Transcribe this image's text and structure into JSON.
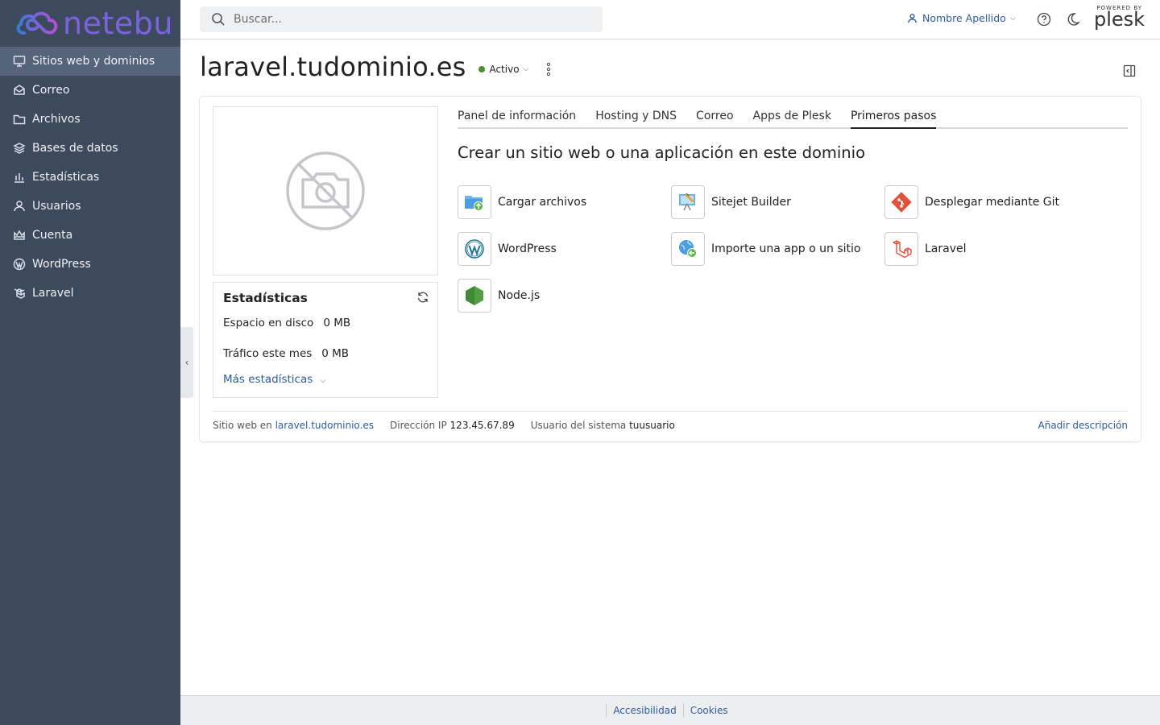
{
  "brand": {
    "logo_text": "netebu",
    "logo_color": "#7d62e0",
    "powered_by": "POWERED BY",
    "plesk": "plesk"
  },
  "sidebar": {
    "items": [
      {
        "label": "Sitios web y dominios",
        "icon": "monitor-icon",
        "active": true
      },
      {
        "label": "Correo",
        "icon": "envelope-icon"
      },
      {
        "label": "Archivos",
        "icon": "folder-icon"
      },
      {
        "label": "Bases de datos",
        "icon": "database-layers-icon"
      },
      {
        "label": "Estadísticas",
        "icon": "bar-chart-icon"
      },
      {
        "label": "Usuarios",
        "icon": "user-icon"
      },
      {
        "label": "Cuenta",
        "icon": "crown-icon"
      },
      {
        "label": "WordPress",
        "icon": "wordpress-icon"
      },
      {
        "label": "Laravel",
        "icon": "laravel-icon"
      }
    ]
  },
  "header": {
    "search_placeholder": "Buscar...",
    "user_name": "Nombre Apellido"
  },
  "domain": {
    "title": "laravel.tudominio.es",
    "status": "Activo",
    "status_color": "#4a8f2a"
  },
  "stats": {
    "title": "Estadísticas",
    "disk_label": "Espacio en disco",
    "disk_value": "0 MB",
    "traffic_label": "Tráfico este mes",
    "traffic_value": "0 MB",
    "more": "Más estadísticas"
  },
  "tabs": [
    {
      "label": "Panel de información"
    },
    {
      "label": "Hosting y DNS"
    },
    {
      "label": "Correo"
    },
    {
      "label": "Apps de Plesk"
    },
    {
      "label": "Primeros pasos",
      "active": true
    }
  ],
  "main": {
    "section_title": "Crear un sitio web o una aplicación en este dominio",
    "apps": [
      {
        "label": "Cargar archivos",
        "icon": "upload-folder-icon"
      },
      {
        "label": "Sitejet Builder",
        "icon": "sitejet-icon"
      },
      {
        "label": "Desplegar mediante Git",
        "icon": "git-icon"
      },
      {
        "label": "WordPress",
        "icon": "wordpress-icon"
      },
      {
        "label": "Importe una app o un sitio",
        "icon": "import-globe-icon"
      },
      {
        "label": "Laravel",
        "icon": "laravel-icon"
      },
      {
        "label": "Node.js",
        "icon": "nodejs-icon"
      }
    ]
  },
  "card_footer": {
    "site_label": "Sitio web en",
    "site_value": "laravel.tudominio.es",
    "ip_label": "Dirección IP",
    "ip_value": "123.45.67.89",
    "sysuser_label": "Usuario del sistema",
    "sysuser_value": "tuusuario",
    "add_description": "Añadir descripción"
  },
  "footer": {
    "accessibility": "Accesibilidad",
    "cookies": "Cookies"
  }
}
